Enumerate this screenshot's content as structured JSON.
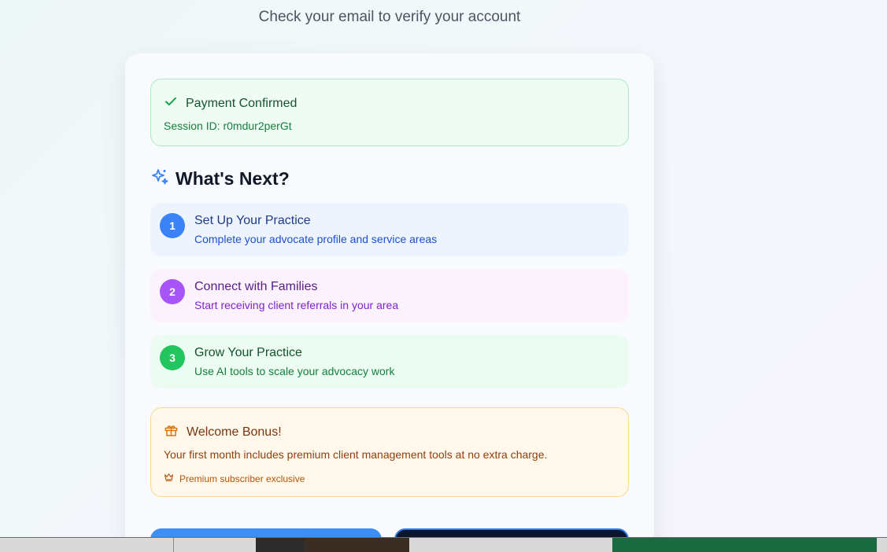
{
  "header": {
    "subtitle": "Check your email to verify your account"
  },
  "payment": {
    "title": "Payment Confirmed",
    "session": "Session ID: r0mdur2perGt",
    "icon": "check-icon"
  },
  "next": {
    "heading": "What's Next?",
    "icon": "sparkles-icon",
    "steps": [
      {
        "num": "1",
        "title": "Set Up Your Practice",
        "desc": "Complete your advocate profile and service areas",
        "color": "#3b82f6"
      },
      {
        "num": "2",
        "title": "Connect with Families",
        "desc": "Start receiving client referrals in your area",
        "color": "#a855f7"
      },
      {
        "num": "3",
        "title": "Grow Your Practice",
        "desc": "Use AI tools to scale your advocacy work",
        "color": "#22c55e"
      }
    ]
  },
  "bonus": {
    "title": "Welcome Bonus!",
    "desc": "Your first month includes premium client management tools at no extra charge.",
    "foot": "Premium subscriber exclusive",
    "icon": "gift-icon",
    "foot_icon": "crown-icon"
  },
  "actions": {
    "primary_color": "#3b8ff6",
    "secondary_color": "#0b1530"
  }
}
